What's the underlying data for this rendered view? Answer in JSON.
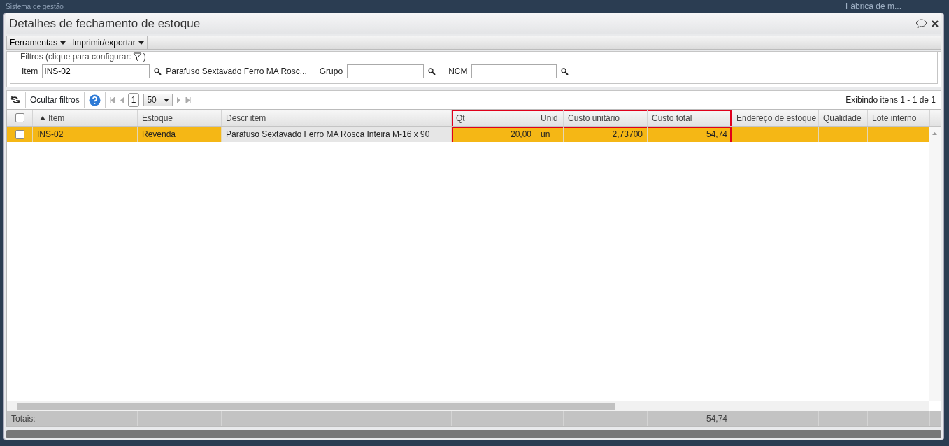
{
  "app_bar": {
    "title": "Sistema de gestão",
    "company": "Fábrica de m..."
  },
  "window": {
    "title": "Detalhes de fechamento de estoque"
  },
  "menus": [
    {
      "label": "Ferramentas"
    },
    {
      "label": "Imprimir/exportar"
    }
  ],
  "filters": {
    "legend": "Filtros (clique para configurar:",
    "legend_end": ")",
    "fields": [
      {
        "label": "Item",
        "value": "INS-02",
        "description": "Parafuso Sextavado Ferro MA Rosc..."
      },
      {
        "label": "Grupo"
      },
      {
        "label": "NCM"
      }
    ]
  },
  "grid_toolbar": {
    "hide_filters": "Ocultar filtros",
    "page": "1",
    "page_size": "50",
    "summary": "Exibindo itens 1 - 1 de 1"
  },
  "table": {
    "header_checked": false,
    "totals_label": "Totais:",
    "columns": [
      {
        "label": "Item",
        "sorted": true,
        "highlighted": false
      },
      {
        "label": "Estoque",
        "highlighted": false
      },
      {
        "label": "Descr item",
        "highlighted": false
      },
      {
        "label": "Qt",
        "highlighted": true,
        "kind": "number"
      },
      {
        "label": "Unid",
        "highlighted": true
      },
      {
        "label": "Custo unitário",
        "highlighted": true,
        "kind": "number"
      },
      {
        "label": "Custo total",
        "highlighted": true,
        "kind": "number",
        "total": "54,74"
      },
      {
        "label": "Endereço de estoque",
        "highlighted": false
      },
      {
        "label": "Qualidade",
        "highlighted": false
      },
      {
        "label": "Lote interno",
        "highlighted": false
      }
    ],
    "rows": [
      {
        "selected": true,
        "checked": false,
        "cells": [
          "INS-02",
          "Revenda",
          "Parafuso Sextavado Ferro MA Rosca Inteira M-16 x 90",
          "20,00",
          "un",
          "2,73700",
          "54,74",
          "",
          "",
          ""
        ]
      }
    ]
  }
}
